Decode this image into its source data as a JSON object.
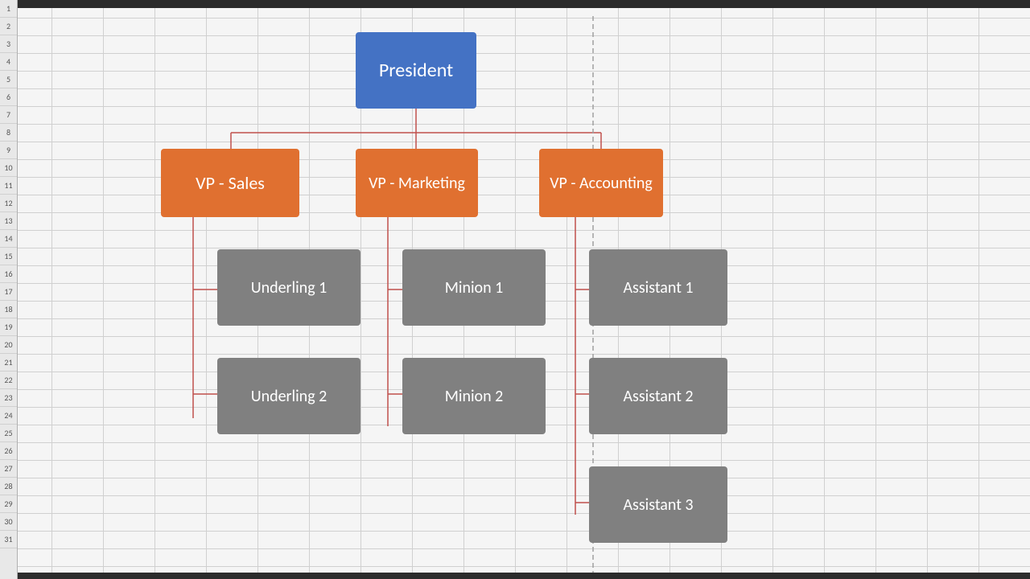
{
  "rows": [
    2,
    3,
    4,
    5,
    6,
    7,
    8,
    9,
    10,
    11,
    12,
    13,
    14,
    15,
    16,
    17,
    18,
    19,
    20,
    21,
    22,
    23,
    24,
    25,
    26,
    27,
    28,
    29,
    30
  ],
  "boxes": {
    "president": {
      "label": "President",
      "color": "blue"
    },
    "vp_sales": {
      "label": "VP - Sales",
      "color": "orange"
    },
    "vp_marketing": {
      "label": "VP - Marketing",
      "color": "orange"
    },
    "vp_accounting": {
      "label": "VP - Accounting",
      "color": "orange"
    },
    "underling1": {
      "label": "Underling 1",
      "color": "gray"
    },
    "underling2": {
      "label": "Underling 2",
      "color": "gray"
    },
    "minion1": {
      "label": "Minion 1",
      "color": "gray"
    },
    "minion2": {
      "label": "Minion 2",
      "color": "gray"
    },
    "assistant1": {
      "label": "Assistant 1",
      "color": "gray"
    },
    "assistant2": {
      "label": "Assistant 2",
      "color": "gray"
    },
    "assistant3": {
      "label": "Assistant 3",
      "color": "gray"
    }
  }
}
